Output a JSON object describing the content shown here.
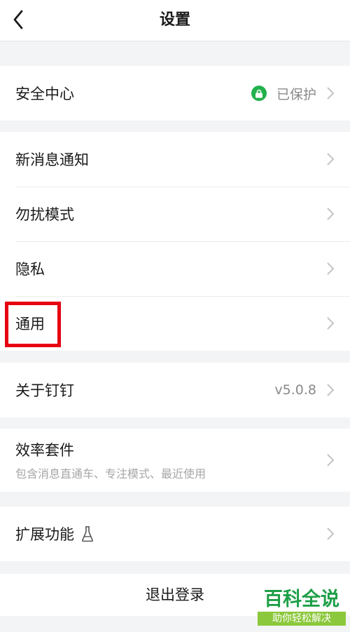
{
  "header": {
    "title": "设置",
    "back_icon": "chevron-left-icon"
  },
  "sections": {
    "security": {
      "label": "安全中心",
      "status": "已保护",
      "status_color": "#22b14c"
    },
    "notifications": {
      "label": "新消息通知"
    },
    "dnd": {
      "label": "勿扰模式"
    },
    "privacy": {
      "label": "隐私"
    },
    "general": {
      "label": "通用"
    },
    "about": {
      "label": "关于钉钉",
      "version": "v5.0.8"
    },
    "efficiency": {
      "label": "效率套件",
      "sub": "包含消息直通车、专注模式、最近使用"
    },
    "extensions": {
      "label": "扩展功能",
      "icon": "flask-icon"
    }
  },
  "logout": {
    "label": "退出登录"
  },
  "highlight_color": "#e60012",
  "watermark": {
    "main": "百科全说",
    "sub": "助你轻松解决"
  }
}
